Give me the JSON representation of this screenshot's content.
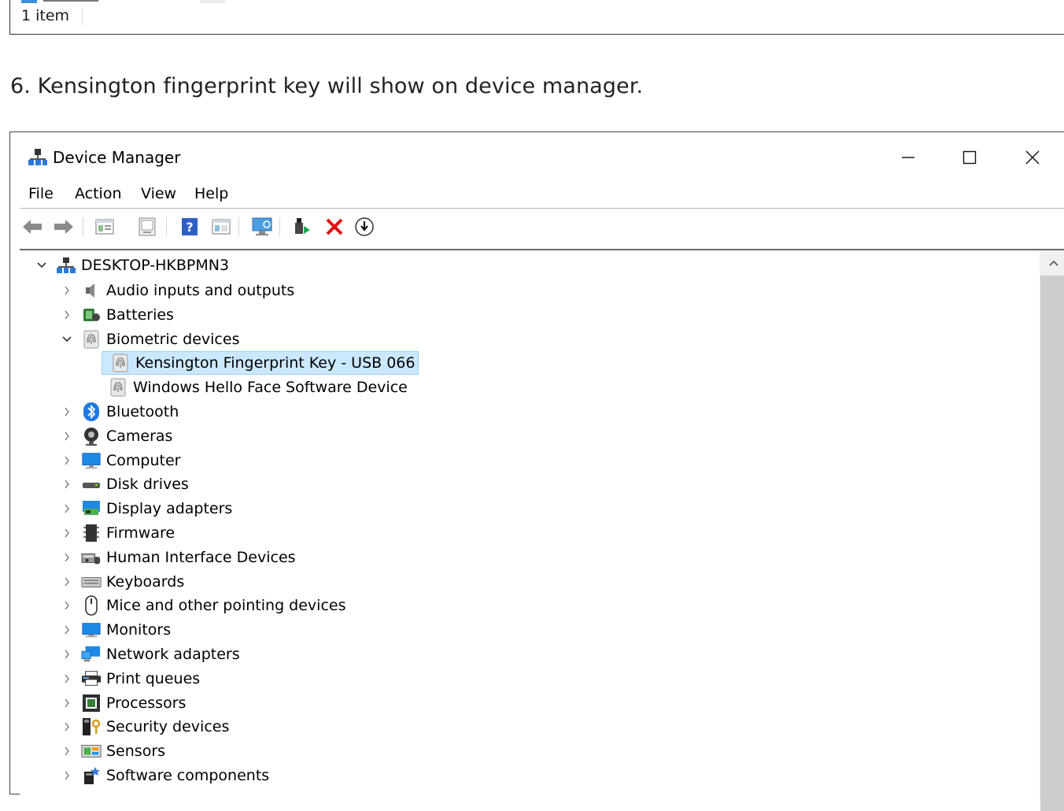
{
  "explorer": {
    "status": "1 item"
  },
  "step": {
    "text": "6.   Kensington fingerprint key will show on device manager."
  },
  "window": {
    "title": "Device Manager",
    "controls": {
      "minimize": "—",
      "maximize": "☐",
      "close": "✕"
    }
  },
  "menu": [
    "File",
    "Action",
    "View",
    "Help"
  ],
  "toolbar": [
    "back-icon",
    "forward-icon",
    "properties-icon",
    "update-icon",
    "help-icon",
    "view-icon",
    "scan-icon",
    "enable-icon",
    "uninstall-icon",
    "download-icon"
  ],
  "tree": {
    "root": "DESKTOP-HKBPMN3",
    "items": [
      {
        "label": "Audio inputs and outputs",
        "icon": "speaker-icon"
      },
      {
        "label": "Batteries",
        "icon": "battery-icon"
      },
      {
        "label": "Biometric devices",
        "icon": "fingerprint-icon",
        "expanded": true
      },
      {
        "label": "Kensington Fingerprint Key - USB 066",
        "icon": "fingerprint-icon",
        "child": true,
        "selected": true
      },
      {
        "label": "Windows Hello Face Software Device",
        "icon": "fingerprint-icon",
        "child": true
      },
      {
        "label": "Bluetooth",
        "icon": "bluetooth-icon"
      },
      {
        "label": "Cameras",
        "icon": "camera-icon"
      },
      {
        "label": "Computer",
        "icon": "computer-icon"
      },
      {
        "label": "Disk drives",
        "icon": "disk-icon"
      },
      {
        "label": "Display adapters",
        "icon": "display-adapter-icon"
      },
      {
        "label": "Firmware",
        "icon": "firmware-icon"
      },
      {
        "label": "Human Interface Devices",
        "icon": "hid-icon"
      },
      {
        "label": "Keyboards",
        "icon": "keyboard-icon"
      },
      {
        "label": "Mice and other pointing devices",
        "icon": "mouse-icon"
      },
      {
        "label": "Monitors",
        "icon": "monitor-icon"
      },
      {
        "label": "Network adapters",
        "icon": "network-icon"
      },
      {
        "label": "Print queues",
        "icon": "printer-icon"
      },
      {
        "label": "Processors",
        "icon": "processor-icon"
      },
      {
        "label": "Security devices",
        "icon": "security-icon"
      },
      {
        "label": "Sensors",
        "icon": "sensor-icon"
      },
      {
        "label": "Software components",
        "icon": "software-icon"
      }
    ]
  }
}
